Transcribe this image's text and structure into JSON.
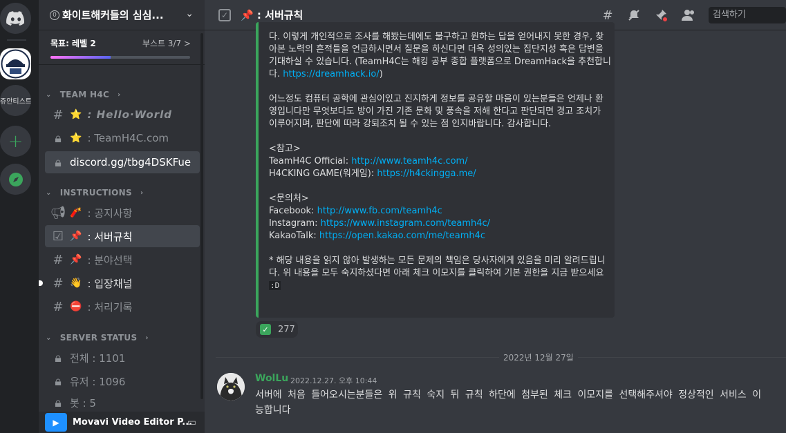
{
  "rail": {
    "third_server_label": "쥬안티스트"
  },
  "server": {
    "badge": "0",
    "name": "화이트해커들의 심심...",
    "boost_goal": "목표: 레벨 2",
    "boost_count": "부스트 3/7 >",
    "boost_progress": 0.43
  },
  "categories": [
    {
      "name": "TEAM H4C"
    },
    {
      "name": "INSTRUCTIONS"
    },
    {
      "name": "SERVER STATUS"
    }
  ],
  "channels": [
    {
      "emoji": "⭐",
      "label": ": Hello·World"
    },
    {
      "emoji": "⭐",
      "label": ": TeamH4C.com"
    },
    {
      "label": "discord.gg/tbg4DSKFue"
    },
    {
      "emoji": "🧨",
      "label": ": 공지사항"
    },
    {
      "emoji": "📌",
      "label": ": 서버규칙"
    },
    {
      "emoji": "📌",
      "label": ": 분야선택"
    },
    {
      "emoji": "👋",
      "label": ": 입장채널"
    },
    {
      "emoji": "⛔",
      "label": ": 처리기록"
    },
    {
      "label": "전체 : 1101"
    },
    {
      "label": "유저 : 1096"
    },
    {
      "label": "봇 : 5"
    }
  ],
  "user_panel": {
    "activity": "Movavi Video Editor P..."
  },
  "topbar": {
    "emoji": "📌",
    "title": ": 서버규칙",
    "search_placeholder": "검색하기"
  },
  "embed": {
    "p1": "다. 이렇게 개인적으로 조사를 해봤는데에도 불구하고 원하는 답을 얻어내지 못한 경우, 찾아본 노력의 흔적들을 언급하시면서 질문을 하신다면 더욱 성의있는 집단지성 혹은 답변을 기대하실 수 있습니다. (TeamH4C는 해킹 공부 종합 플랫폼으로 DreamHack을 추천합니다. ",
    "p1_link": "https://dreamhack.io/",
    "p1_tail": ")",
    "p2": "어느정도 컴퓨터 공학에 관심이있고 진지하게 정보를 공유할 마음이 있는분들은 언제나 환영입니다만 무엇보다도 방이 가진 기존 문화 및 풍속을 저해 한다고 판단되면 경고 조치가 이루어지며, 판단에 따라 강퇴조치 될 수 있는 점 인지바랍니다. 감사합니다.",
    "ref_title": "<참고>",
    "ref1_label": "TeamH4C Official: ",
    "ref1_link": "http://www.teamh4c.com/",
    "ref2_label": "H4CKING GAME(워게임): ",
    "ref2_link": "https://h4ckingga.me/",
    "contact_title": "<문의처>",
    "c1_label": "Facebook: ",
    "c1_link": "http://www.fb.com/teamh4c",
    "c2_label": "Instagram: ",
    "c2_link": "https://www.instagram.com/teamh4c/",
    "c3_label": "KakaoTalk: ",
    "c3_link": "https://open.kakao.com/me/teamh4c",
    "notice": "* 해당 내용을 읽지 않아 발생하는 모든 문제의 책임은 당사자에게 있음을 미리 알려드립니다. 위 내용을 모두 숙지하셨다면 아래 체크 이모지를 클릭하여 기본 권한을 지금 받으세요 ",
    "notice_code": ":D"
  },
  "reaction": {
    "emoji": "✓",
    "count": "277"
  },
  "date_divider": "2022년 12월 27일",
  "message": {
    "author": "WolLu",
    "timestamp": "2022.12.27. 오후 10:44",
    "line1": "서버에 처음 들어오시는분들은 위 규칙 숙지 뒤 규칙 하단에 첨부된 체크 이모지를 선택해주셔야 정상적인 서비스 이",
    "line2": "능합니다"
  }
}
